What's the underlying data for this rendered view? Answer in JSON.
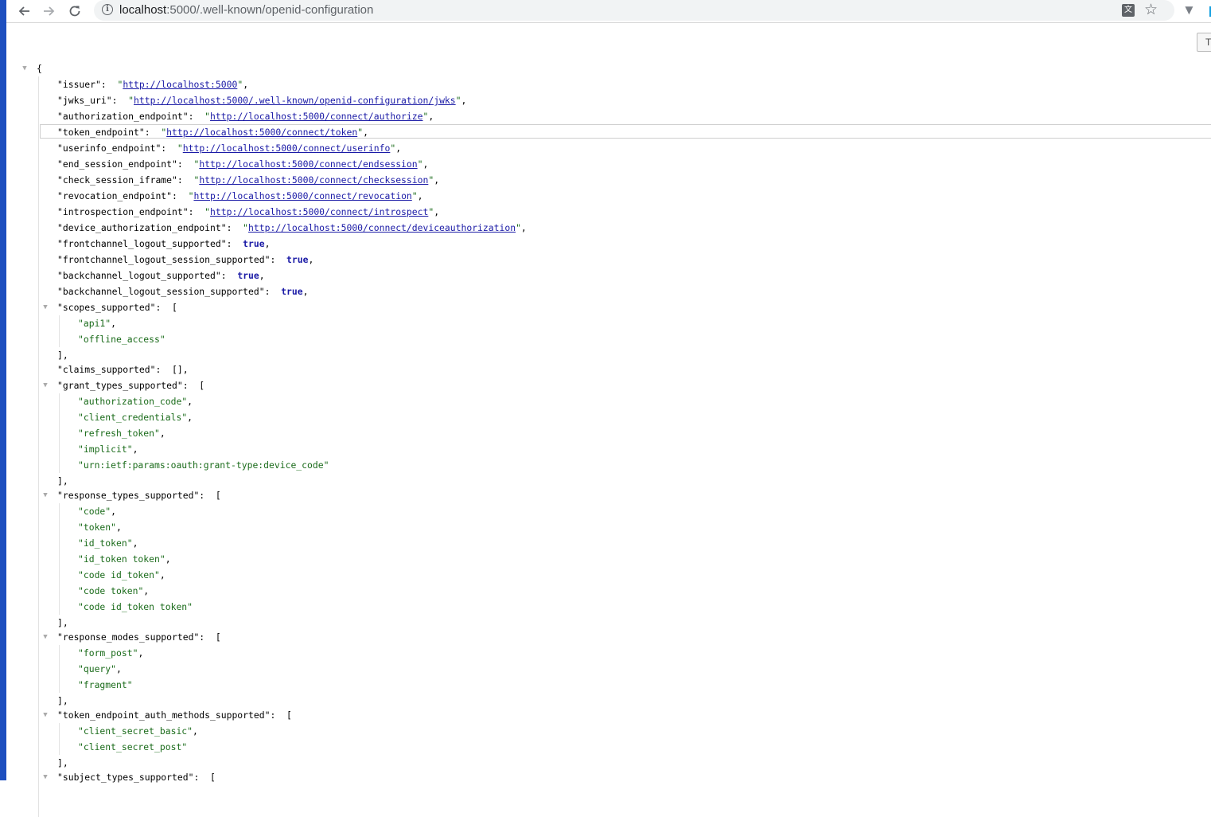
{
  "browser": {
    "url_host": "localhost",
    "url_path": ":5000/.well-known/openid-configuration",
    "icons": [
      "back-arrow-icon",
      "forward-arrow-icon",
      "reload-icon",
      "info-icon",
      "translate-icon",
      "star-icon",
      "extension-v-icon",
      "extension-color-icon"
    ],
    "raw_toggle_label": "T"
  },
  "json": {
    "open_brace": "{",
    "scalars": [
      {
        "key": "issuer",
        "value": "http://localhost:5000",
        "type": "link"
      },
      {
        "key": "jwks_uri",
        "value": "http://localhost:5000/.well-known/openid-configuration/jwks",
        "type": "link"
      },
      {
        "key": "authorization_endpoint",
        "value": "http://localhost:5000/connect/authorize",
        "type": "link"
      },
      {
        "key": "token_endpoint",
        "value": "http://localhost:5000/connect/token",
        "type": "link"
      },
      {
        "key": "userinfo_endpoint",
        "value": "http://localhost:5000/connect/userinfo",
        "type": "link"
      },
      {
        "key": "end_session_endpoint",
        "value": "http://localhost:5000/connect/endsession",
        "type": "link"
      },
      {
        "key": "check_session_iframe",
        "value": "http://localhost:5000/connect/checksession",
        "type": "link"
      },
      {
        "key": "revocation_endpoint",
        "value": "http://localhost:5000/connect/revocation",
        "type": "link"
      },
      {
        "key": "introspection_endpoint",
        "value": "http://localhost:5000/connect/introspect",
        "type": "link"
      },
      {
        "key": "device_authorization_endpoint",
        "value": "http://localhost:5000/connect/deviceauthorization",
        "type": "link"
      },
      {
        "key": "frontchannel_logout_supported",
        "value": "true",
        "type": "bool"
      },
      {
        "key": "frontchannel_logout_session_supported",
        "value": "true",
        "type": "bool"
      },
      {
        "key": "backchannel_logout_supported",
        "value": "true",
        "type": "bool"
      },
      {
        "key": "backchannel_logout_session_supported",
        "value": "true",
        "type": "bool"
      }
    ],
    "scopes_supported": {
      "key": "scopes_supported",
      "items": [
        "api1",
        "offline_access"
      ]
    },
    "claims_supported": {
      "key": "claims_supported",
      "value": "[]"
    },
    "grant_types_supported": {
      "key": "grant_types_supported",
      "items": [
        "authorization_code",
        "client_credentials",
        "refresh_token",
        "implicit",
        "urn:ietf:params:oauth:grant-type:device_code"
      ]
    },
    "response_types_supported": {
      "key": "response_types_supported",
      "items": [
        "code",
        "token",
        "id_token",
        "id_token token",
        "code id_token",
        "code token",
        "code id_token token"
      ]
    },
    "response_modes_supported": {
      "key": "response_modes_supported",
      "items": [
        "form_post",
        "query",
        "fragment"
      ]
    },
    "token_endpoint_auth_methods_supported": {
      "key": "token_endpoint_auth_methods_supported",
      "items": [
        "client_secret_basic",
        "client_secret_post"
      ]
    },
    "subject_types_supported": {
      "key": "subject_types_supported"
    }
  }
}
